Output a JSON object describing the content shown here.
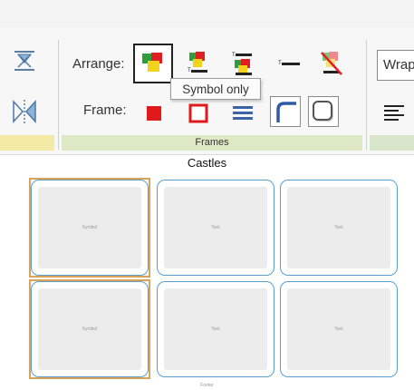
{
  "ribbon": {
    "arrange_label": "Arrange:",
    "frame_label": "Frame:",
    "group_label": "Frames",
    "tooltip": "Symbol only",
    "wrap_label": "Wrap",
    "arrange_options": [
      "symbol-only-icon",
      "symbol-text-below-icon",
      "symbol-text-above-icon",
      "text-only-icon",
      "no-symbol-icon"
    ],
    "frame_options": [
      "frame-filled-icon",
      "frame-outline-icon",
      "frame-lines-icon",
      "frame-rounded-corner-icon",
      "frame-rounded-icon"
    ]
  },
  "title": "Castles",
  "grid": {
    "rows": [
      [
        "Symbol",
        "Text",
        "Text"
      ],
      [
        "Symbol",
        "Text",
        "Text"
      ]
    ]
  },
  "footer": "Footer",
  "colors": {
    "accent_blue": "#5a9fd0",
    "selection_orange": "#d9a35a",
    "frames_band": "#dde9c4"
  }
}
